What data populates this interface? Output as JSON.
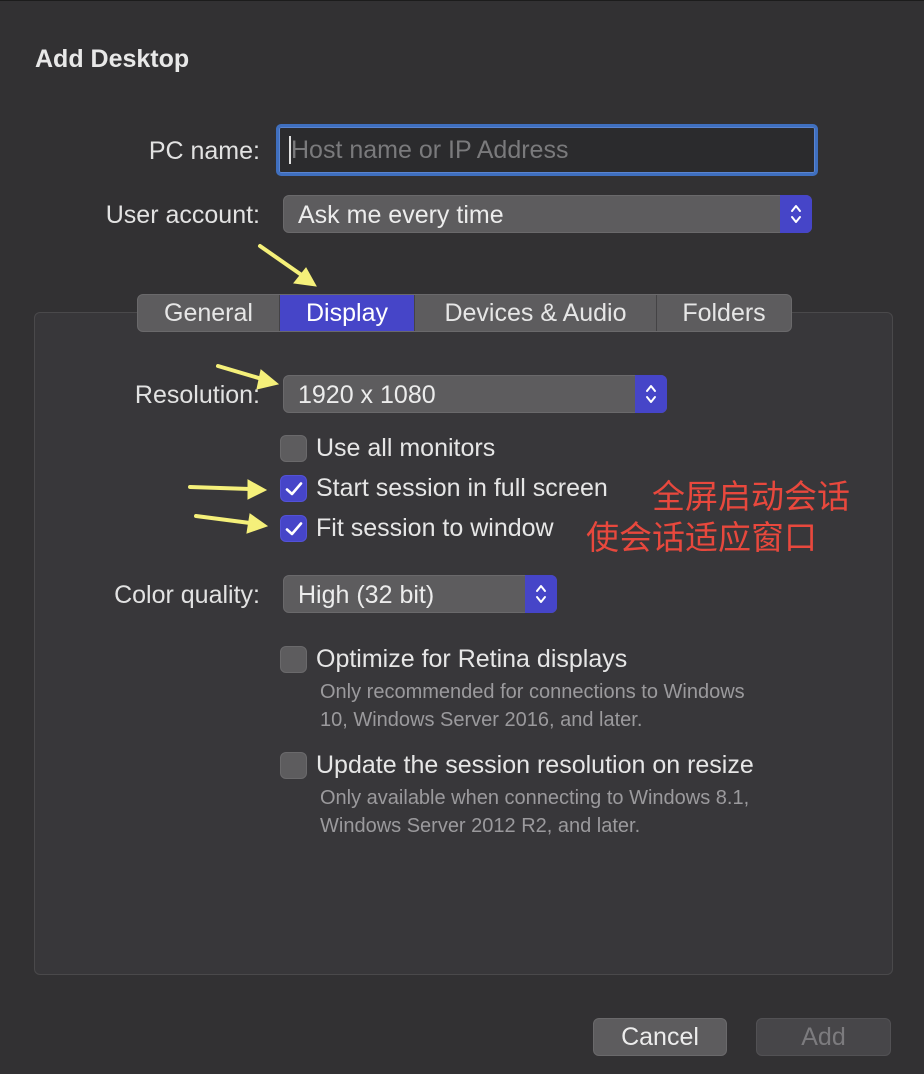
{
  "dialog": {
    "title": "Add Desktop"
  },
  "pc_name": {
    "label": "PC name:",
    "value": "",
    "placeholder": "Host name or IP Address"
  },
  "user_account": {
    "label": "User account:",
    "value": "Ask me every time"
  },
  "tabs": [
    {
      "label": "General",
      "active": false
    },
    {
      "label": "Display",
      "active": true
    },
    {
      "label": "Devices & Audio",
      "active": false
    },
    {
      "label": "Folders",
      "active": false
    }
  ],
  "display": {
    "resolution": {
      "label": "Resolution:",
      "value": "1920 x 1080"
    },
    "use_all_monitors": {
      "label": "Use all monitors",
      "checked": false
    },
    "full_screen": {
      "label": "Start session in full screen",
      "checked": true
    },
    "fit_window": {
      "label": "Fit session to window",
      "checked": true
    },
    "color_quality": {
      "label": "Color quality:",
      "value": "High (32 bit)"
    },
    "retina": {
      "label": "Optimize for Retina displays",
      "checked": false,
      "help": [
        "Only recommended for connections to Windows",
        "10, Windows Server 2016, and later."
      ]
    },
    "update_resolution": {
      "label": "Update the session resolution on resize",
      "checked": false,
      "help": [
        "Only available when connecting to Windows 8.1,",
        "Windows Server 2012 R2, and later."
      ]
    }
  },
  "annotations": {
    "full_screen_note": "全屏启动会话",
    "fit_window_note": "使会话适应窗口",
    "arrow_color": "#f5f07a"
  },
  "footer": {
    "cancel_label": "Cancel",
    "add_label": "Add"
  },
  "colors": {
    "accent": "#4645c8",
    "background": "#323133",
    "annotation_text": "#e8483d"
  }
}
